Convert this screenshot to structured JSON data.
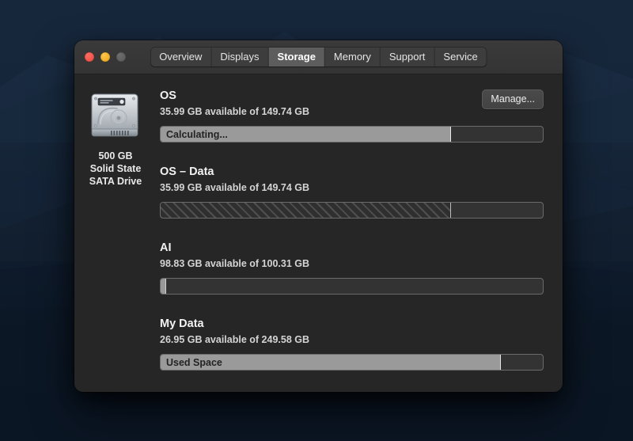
{
  "window": {
    "traffic_lights": [
      {
        "name": "close",
        "color": "#e8463d"
      },
      {
        "name": "minimize",
        "color": "#e8a317"
      },
      {
        "name": "zoom",
        "color": "#565656"
      }
    ],
    "tabs": [
      {
        "label": "Overview",
        "selected": false
      },
      {
        "label": "Displays",
        "selected": false
      },
      {
        "label": "Storage",
        "selected": true
      },
      {
        "label": "Memory",
        "selected": false
      },
      {
        "label": "Support",
        "selected": false
      },
      {
        "label": "Service",
        "selected": false
      }
    ]
  },
  "drive": {
    "icon": "hard-drive-icon",
    "capacity": "500 GB",
    "type_line1": "Solid State",
    "type_line2": "SATA Drive"
  },
  "manage_button": {
    "label": "Manage..."
  },
  "volumes": [
    {
      "name": "OS",
      "availability": "35.99 GB available of 149.74 GB",
      "bar": {
        "style": "solid",
        "label": "Calculating...",
        "fill_percent": 76
      }
    },
    {
      "name": "OS – Data",
      "availability": "35.99 GB available of 149.74 GB",
      "bar": {
        "style": "striped",
        "label": "",
        "fill_percent": 76
      }
    },
    {
      "name": "AI",
      "availability": "98.83 GB available of 100.31 GB",
      "bar": {
        "style": "sliver",
        "label": "",
        "fill_percent": 1.5
      }
    },
    {
      "name": "My Data",
      "availability": "26.95 GB available of 249.58 GB",
      "bar": {
        "style": "solid",
        "label": "Used Space",
        "fill_percent": 89
      }
    }
  ],
  "colors": {
    "window_bg": "#262626",
    "titlebar_bg": "#343434",
    "bar_fill": "#9a9a9a",
    "bar_track": "#333333",
    "text_primary": "#f2f2f2",
    "text_secondary": "#d4d4d4"
  }
}
